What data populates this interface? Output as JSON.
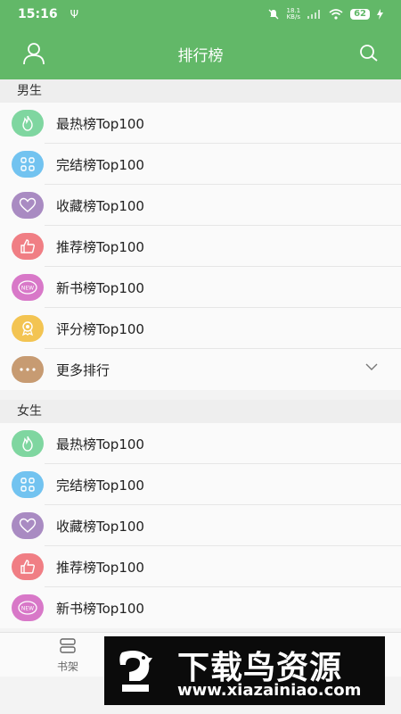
{
  "status": {
    "time": "15:16",
    "usb": "Ψ",
    "speed_value": "18.1",
    "speed_unit": "KB/s",
    "battery": "62"
  },
  "header": {
    "title": "排行榜",
    "user_icon": "user-icon",
    "search_icon": "search-icon"
  },
  "sections": {
    "male": {
      "label": "男生",
      "items": [
        {
          "label": "最热榜Top100",
          "icon": "fire-icon",
          "color": "#7fd6a0"
        },
        {
          "label": "完结榜Top100",
          "icon": "grid-icon",
          "color": "#72c3f0"
        },
        {
          "label": "收藏榜Top100",
          "icon": "heart-icon",
          "color": "#a98bc2"
        },
        {
          "label": "推荐榜Top100",
          "icon": "thumbs-up-icon",
          "color": "#f07e84"
        },
        {
          "label": "新书榜Top100",
          "icon": "new-badge-icon",
          "color": "#d878c8"
        },
        {
          "label": "评分榜Top100",
          "icon": "award-icon",
          "color": "#f3c452"
        },
        {
          "label": "更多排行",
          "icon": "more-dots-icon",
          "color": "#c79b72"
        }
      ]
    },
    "female": {
      "label": "女生",
      "items": [
        {
          "label": "最热榜Top100",
          "icon": "fire-icon",
          "color": "#7fd6a0"
        },
        {
          "label": "完结榜Top100",
          "icon": "grid-icon",
          "color": "#72c3f0"
        },
        {
          "label": "收藏榜Top100",
          "icon": "heart-icon",
          "color": "#a98bc2"
        },
        {
          "label": "推荐榜Top100",
          "icon": "thumbs-up-icon",
          "color": "#f07e84"
        },
        {
          "label": "新书榜Top100",
          "icon": "new-badge-icon",
          "color": "#d878c8"
        }
      ]
    }
  },
  "bottom_nav": {
    "shelf_label": "书架",
    "shelf_icon": "bookshelf-icon"
  },
  "watermark": {
    "title": "下载鸟资源",
    "url": "www.xiazainiao.com"
  },
  "colors": {
    "brand_green": "#62b868"
  }
}
